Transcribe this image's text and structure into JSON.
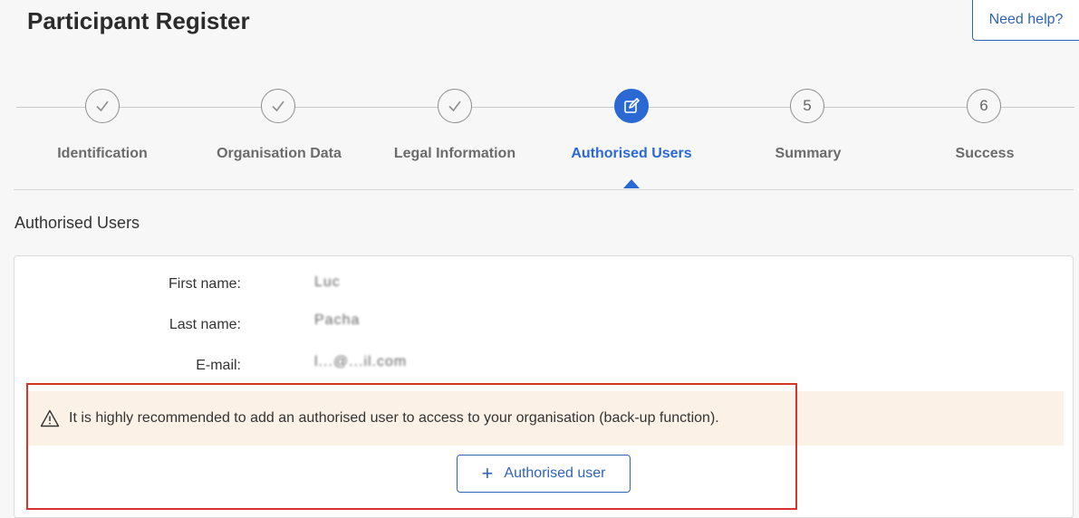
{
  "header": {
    "title": "Participant Register",
    "help_label": "Need help?"
  },
  "stepper": {
    "steps": [
      {
        "label": "Identification",
        "state": "completed",
        "number": ""
      },
      {
        "label": "Organisation Data",
        "state": "completed",
        "number": ""
      },
      {
        "label": "Legal Information",
        "state": "completed",
        "number": ""
      },
      {
        "label": "Authorised Users",
        "state": "active",
        "number": ""
      },
      {
        "label": "Summary",
        "state": "pending",
        "number": "5"
      },
      {
        "label": "Success",
        "state": "pending",
        "number": "6"
      }
    ],
    "active_color": "#2a69d4"
  },
  "section": {
    "title": "Authorised Users"
  },
  "user": {
    "first_name_label": "First name:",
    "first_name_value": "Luc",
    "last_name_label": "Last name:",
    "last_name_value": "Pacha",
    "email_label": "E-mail:",
    "email_value": "l...@...il.com"
  },
  "warning": {
    "text": "It is highly recommended to add an authorised user to access to your organisation (back-up function).",
    "background_color": "#fcf1e6"
  },
  "actions": {
    "add_user_label": "Authorised user"
  },
  "highlight_color": "#d9342b"
}
